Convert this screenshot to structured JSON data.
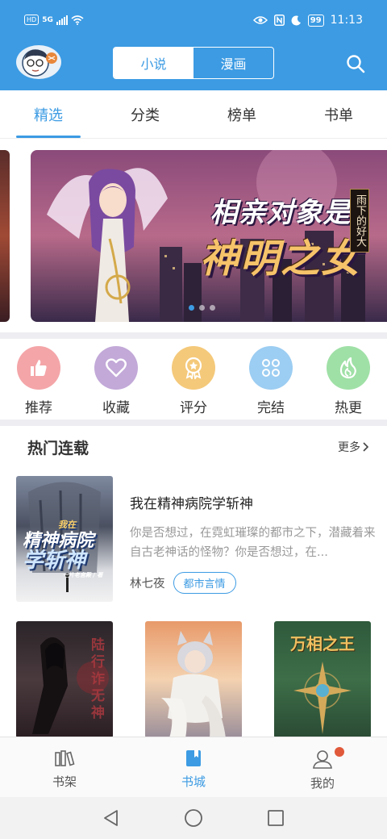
{
  "status_bar": {
    "network_badge": "HD",
    "network_type": "5G",
    "battery": "99",
    "time": "11:13"
  },
  "header": {
    "segments": [
      "小说",
      "漫画"
    ],
    "active_segment": "小说",
    "icons": [
      "avatar",
      "search-icon"
    ]
  },
  "tabs": [
    "精选",
    "分类",
    "榜单",
    "书单"
  ],
  "active_tab": "精选",
  "banner": {
    "title_line1": "相亲对象是",
    "title_line2": "神明之女",
    "author_badge": "雨下的好大",
    "slide_count": 3
  },
  "shortcuts": [
    {
      "label": "推荐",
      "icon": "thumbs-up-icon",
      "color": "#f4a5a8"
    },
    {
      "label": "收藏",
      "icon": "heart-icon",
      "color": "#c2a9d8"
    },
    {
      "label": "评分",
      "icon": "medal-icon",
      "color": "#f4c97a"
    },
    {
      "label": "完结",
      "icon": "grid-icon",
      "color": "#9ccdf2"
    },
    {
      "label": "热更",
      "icon": "flame-icon",
      "color": "#9fe0a6"
    }
  ],
  "section": {
    "title": "热门连载",
    "more": "更多"
  },
  "featured_book": {
    "title": "我在精神病院学斩神",
    "description": "你是否想过，在霓虹璀璨的都市之下，潜藏着来自古老神话的怪物？你是否想过，在...",
    "author": "林七夜",
    "tag": "都市言情",
    "cover_text": {
      "line1": "我在",
      "line2": "精神病院",
      "line3": "学斩神",
      "line4": "一片老宫殿 / 著"
    }
  },
  "grid_books": [
    {
      "cover_text": "陆行诈无神"
    },
    {
      "cover_text": ""
    },
    {
      "cover_text": "万相之王"
    }
  ],
  "bottom_nav": [
    {
      "label": "书架",
      "icon": "bookshelf-icon"
    },
    {
      "label": "书城",
      "icon": "bookstore-icon"
    },
    {
      "label": "我的",
      "icon": "profile-icon"
    }
  ],
  "active_nav": "书城",
  "colors": {
    "primary": "#3c9be3",
    "notification": "#e0593a"
  }
}
